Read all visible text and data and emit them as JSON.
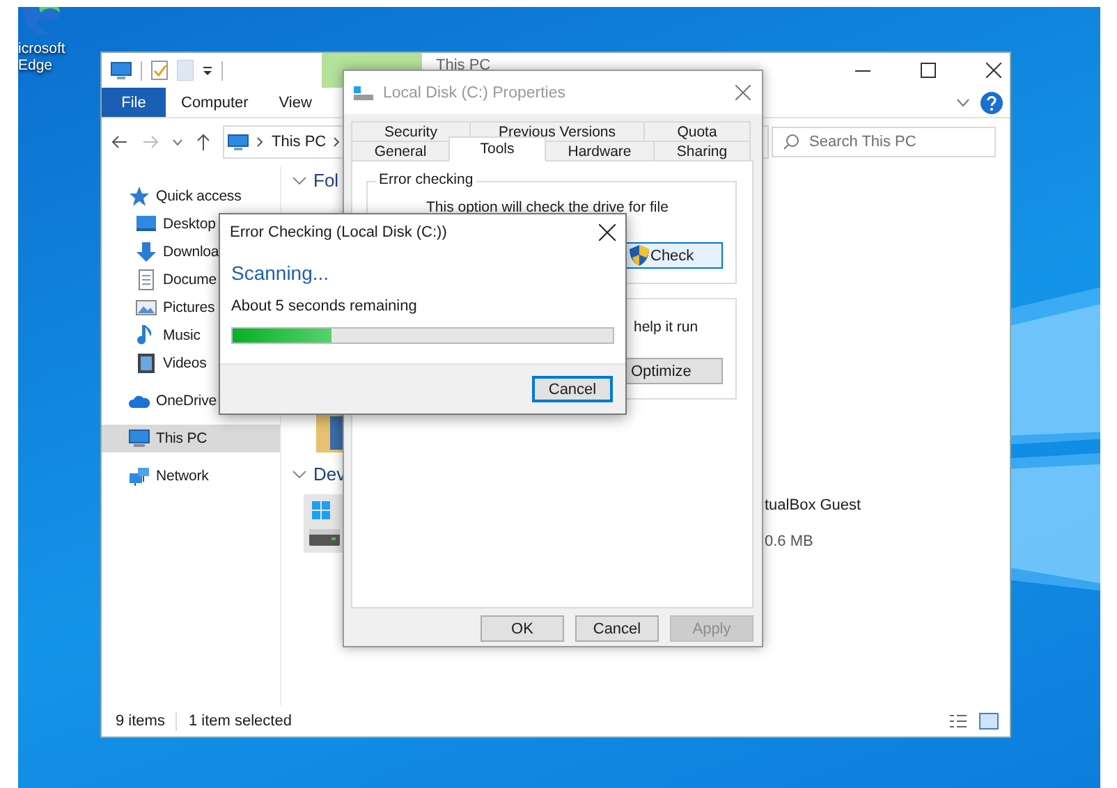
{
  "desktop": {
    "icons": [
      {
        "label": "icrosoft Edge"
      }
    ]
  },
  "explorer": {
    "title": "This PC",
    "file_tab": "File",
    "ribbon_tabs": [
      {
        "label": "Computer"
      },
      {
        "label": "View"
      }
    ],
    "address": "This PC",
    "search": {
      "placeholder": "Search This PC"
    },
    "navigation": [
      {
        "label": "Quick access",
        "selected": false,
        "children": [
          {
            "label": "Desktop",
            "selected": false
          },
          {
            "label": "Downloa",
            "selected": false
          },
          {
            "label": "Docume",
            "selected": false
          },
          {
            "label": "Pictures",
            "selected": false
          },
          {
            "label": "Music",
            "selected": false
          },
          {
            "label": "Videos",
            "selected": false
          }
        ]
      },
      {
        "label": "OneDrive",
        "selected": false
      },
      {
        "label": "This PC",
        "selected": true
      },
      {
        "label": "Network",
        "selected": false
      }
    ],
    "sections": [
      {
        "heading": "Fol"
      },
      {
        "heading": "Dev"
      }
    ],
    "device": {
      "name": "tualBox Guest",
      "size": "0.6 MB"
    },
    "status_bar": {
      "item_count": "9 items",
      "selection": "1 item selected"
    }
  },
  "properties": {
    "title": "Local Disk (C:) Properties",
    "tab_rows": [
      [
        {
          "label": "Security",
          "selected": false
        },
        {
          "label": "Previous Versions",
          "selected": false
        },
        {
          "label": "Quota",
          "selected": false
        }
      ],
      [
        {
          "label": "General",
          "selected": false
        },
        {
          "label": "Tools",
          "selected": true
        },
        {
          "label": "Hardware",
          "selected": false
        },
        {
          "label": "Sharing",
          "selected": false
        }
      ]
    ],
    "error_checking": {
      "legend": "Error checking",
      "description": "This option will check the drive for file",
      "button": "Check"
    },
    "optimize": {
      "description": "help it run",
      "button": "Optimize"
    },
    "buttons": [
      {
        "label": "OK",
        "disabled": false
      },
      {
        "label": "Cancel",
        "disabled": false
      },
      {
        "label": "Apply",
        "disabled": true
      }
    ]
  },
  "error_dialog": {
    "title": "Error Checking (Local Disk (C:))",
    "status": "Scanning...",
    "remaining": "About 5 seconds remaining",
    "progress": {
      "level": 0.26
    },
    "button": "Cancel"
  }
}
